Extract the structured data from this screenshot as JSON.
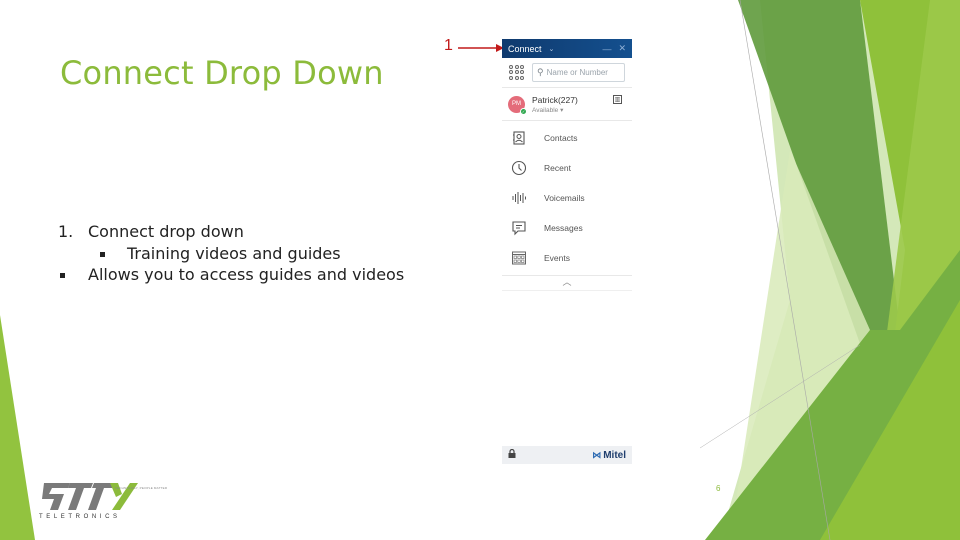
{
  "slide": {
    "title": "Connect Drop Down",
    "page_number": "6",
    "accent_color": "#8cbb3b",
    "bullets": [
      {
        "marker": "1.",
        "text": "Connect drop down",
        "level": 0
      },
      {
        "marker": "square",
        "text": "Training videos and guides",
        "level": 1
      },
      {
        "marker": "square",
        "text": "Allows you to access guides and videos",
        "level": 0
      }
    ],
    "callout": {
      "label": "1",
      "color": "#c21a1a"
    }
  },
  "panel": {
    "header": {
      "title": "Connect",
      "chevron": "⌄",
      "minimize": "—",
      "close": "✕",
      "color": "#14508f"
    },
    "search": {
      "placeholder": "Name or Number",
      "icon": "search-icon"
    },
    "dialpad_icon": "dialpad-icon",
    "user": {
      "initials": "PM",
      "name": "Patrick(227)",
      "status": "Available ▾",
      "status_color": "#2fa84f",
      "avatar_color": "#e46c7a"
    },
    "nav": [
      {
        "label": "Contacts",
        "icon": "contacts-icon"
      },
      {
        "label": "Recent",
        "icon": "clock-icon"
      },
      {
        "label": "Voicemails",
        "icon": "voicemail-icon"
      },
      {
        "label": "Messages",
        "icon": "message-icon"
      },
      {
        "label": "Events",
        "icon": "calendar-icon"
      }
    ],
    "collapse_glyph": "︿",
    "footer": {
      "lock_glyph": "🔒",
      "brand": "Mitel",
      "brand_glyph": "⋈"
    }
  },
  "logo": {
    "name": "TTX",
    "subtitle": "TELETRONICS",
    "tagline": "TECHNOLOGY, PEOPLE MATTER"
  }
}
